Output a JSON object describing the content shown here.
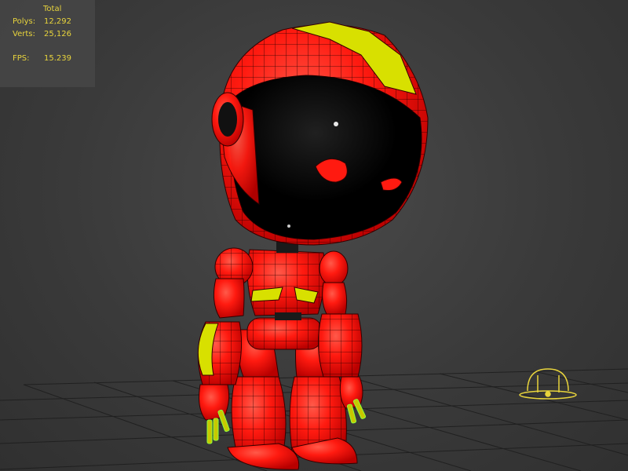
{
  "stats": {
    "header": "Total",
    "rows": [
      {
        "label": "Polys:",
        "value": "12,292"
      },
      {
        "label": "Verts:",
        "value": "25,126"
      },
      {
        "label": "FPS:",
        "value": "15.239"
      }
    ]
  },
  "colors": {
    "robot_body": "#ff1010",
    "robot_accent": "#d8e000",
    "visor": "#000000",
    "wire": "#1a0000",
    "grid": "#1e1e1e",
    "light_gizmo": "#e8d43c",
    "stats_text": "#e8d43c",
    "selected_fingers": "#8cff3c"
  },
  "viewport": {
    "object": "robot-character",
    "gizmo": "light-icon"
  }
}
